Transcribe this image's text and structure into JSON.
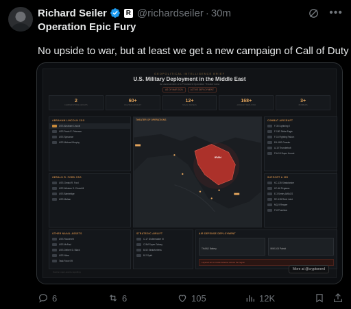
{
  "tweet": {
    "author_name": "Richard Seiler",
    "handle": "@richardseiler",
    "separator": "·",
    "time": "30m",
    "title": "Operation Epic Fury",
    "body": "No upside to war, but at least we get a new campaign of Call of Duty"
  },
  "media": {
    "sup_title": "GEOPOLITICAL INTELLIGENCE BRIEF",
    "title": "U.S. Military Deployment in the Middle East",
    "subtitle": "An assessment of a Persistent Operation Theater Area",
    "pills": [
      "AS OF MAR 2026",
      "ACTIVE DEPLOYMENT"
    ],
    "stats": [
      {
        "value": "2",
        "label": "CARRIER STRIKE GROUPS"
      },
      {
        "value": "60+",
        "label": "FIGHTER AIRCRAFT"
      },
      {
        "value": "12+",
        "label": "NAVAL VESSELS"
      },
      {
        "value": "168+",
        "label": "AIRCRAFT DEPLOYED"
      },
      {
        "value": "3+",
        "label": "BOMBERS"
      }
    ],
    "panels": {
      "lincoln": {
        "title": "ABRAHAM LINCOLN CSG",
        "rows": [
          "USS Abraham Lincoln",
          "USS Frank E. Petersen",
          "USS Spruance",
          "USS Michael Murphy"
        ]
      },
      "theater": {
        "title": "THEATER OF OPERATIONS"
      },
      "combat": {
        "title": "COMBAT AIRCRAFT",
        "rows": [
          "F-35 Lightning II",
          "F-15E Strike Eagle",
          "F-16 Fighting Falcon",
          "EA-18G Growler",
          "A-10 Thunderbolt",
          "F/A-18 Super Hornet"
        ]
      },
      "ford": {
        "title": "GERALD R. FORD CSG",
        "rows": [
          "USS Gerald R. Ford",
          "USS Winston S. Churchill",
          "USS Bainbridge",
          "USS Mahan"
        ]
      },
      "support": {
        "title": "SUPPORT & ISR",
        "rows": [
          "KC-135 Stratotanker",
          "KC-46 Pegasus",
          "E-3 Sentry AWACS",
          "RC-135 Rivet Joint",
          "MQ-9 Reaper",
          "P-8 Poseidon"
        ]
      },
      "naval": {
        "title": "OTHER NAVAL ASSETS",
        "rows": [
          "USS Roosevelt",
          "USS McFaul",
          "USS Delbert D. Black",
          "USS Nitze",
          "Task Force 59"
        ]
      },
      "strategic": {
        "title": "STRATEGIC AIRLIFT",
        "rows": [
          "C-17 Globemaster III",
          "C-5M Super Galaxy",
          "B-52 Stratofortress",
          "B-2 Spirit"
        ]
      },
      "airdef": {
        "title": "AIR DEFENSE DEPLOYMENT",
        "items": [
          "THAAD Battery",
          "MIM-104 Patriot"
        ],
        "alert": "Layered air & missile defense across the region"
      }
    },
    "map_labels": {
      "iran": "IRAN"
    },
    "footer_left": "Source: open-source reporting",
    "more_button": "More at @cryptonerd"
  },
  "actions": {
    "reply_count": "6",
    "repost_count": "6",
    "like_count": "105",
    "views_count": "12K"
  },
  "colors": {
    "verified_blue": "#1d9bf0",
    "accent_orange": "#c88847",
    "iran_red": "#b8342c"
  }
}
